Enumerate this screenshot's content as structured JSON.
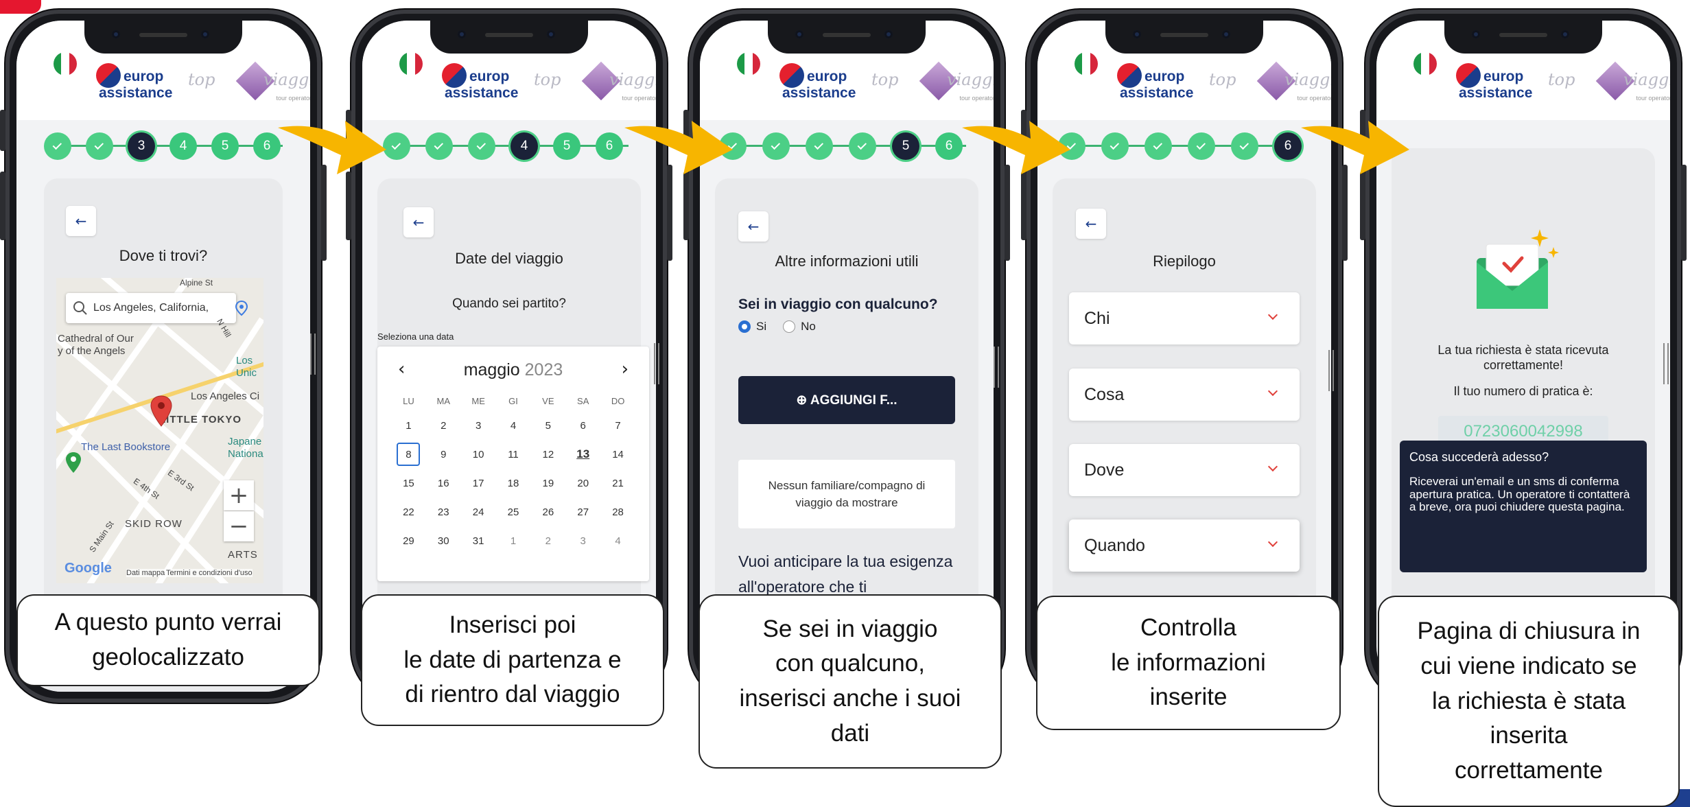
{
  "brand": {
    "logo_left_line1": "europ",
    "logo_left_line2": "assistance",
    "logo_right_left": "top",
    "logo_right_right": "viaggi",
    "logo_right_sub": "tour operator"
  },
  "colors": {
    "accent_green": "#3ac77c",
    "dark_navy": "#1b2238",
    "arrow_yellow": "#f7b500",
    "brand_red": "#e5172f",
    "brand_blue": "#1b3d8c"
  },
  "steps": [
    "1",
    "2",
    "3",
    "4",
    "5",
    "6"
  ],
  "screens": [
    {
      "current_step": 3,
      "title": "Dove ti trovi?",
      "back_label": "←",
      "map": {
        "search_value": "Los Angeles, California,",
        "places": [
          "Cathedral of Our",
          "y of the Angels",
          "Los",
          "Unic",
          "Los Angeles Ci",
          "LITTLE TOKYO",
          "The Last Bookstore",
          "Japane",
          "Nationa",
          "SKID ROW",
          "ARTS",
          "Alpine St",
          "N Hill",
          "E 3rd St",
          "E 4th St",
          "S Main St"
        ],
        "zoom_in": "+",
        "zoom_out": "−",
        "footer_data": "Dati mappa",
        "footer_terms": "Termini e condizioni d'uso",
        "google": "Google"
      },
      "caption": "A questo punto verrai geolocalizzato"
    },
    {
      "current_step": 4,
      "title": "Date del viaggio",
      "subtitle": "Quando sei partito?",
      "back_label": "←",
      "select_label": "Seleziona una data",
      "calendar": {
        "month": "maggio",
        "year": "2023",
        "prev": "‹",
        "next": "›",
        "weekdays": [
          "LU",
          "MA",
          "ME",
          "GI",
          "VE",
          "SA",
          "DO"
        ],
        "days": [
          "1",
          "2",
          "3",
          "4",
          "5",
          "6",
          "7",
          "8",
          "9",
          "10",
          "11",
          "12",
          "13",
          "14",
          "15",
          "16",
          "17",
          "18",
          "19",
          "20",
          "21",
          "22",
          "23",
          "24",
          "25",
          "26",
          "27",
          "28",
          "29",
          "30",
          "31",
          "1",
          "2",
          "3",
          "4"
        ],
        "selected": "8",
        "today": "13"
      },
      "caption_lines": [
        "Inserisci poi",
        "le date di partenza e",
        "di rientro dal viaggio"
      ]
    },
    {
      "current_step": 5,
      "title": "Altre informazioni utili",
      "back_label": "←",
      "question": "Sei in viaggio con qualcuno?",
      "radio_yes": "Si",
      "radio_no": "No",
      "add_button": "⊕ AGGIUNGI F...",
      "empty_text": "Nessun familiare/compagno di viaggio da mostrare",
      "followup": "Vuoi anticipare la tua esigenza all'operatore che ti",
      "caption_lines": [
        "Se sei in viaggio",
        "con qualcuno,",
        "inserisci anche i suoi",
        "dati"
      ]
    },
    {
      "current_step": 6,
      "title": "Riepilogo",
      "back_label": "←",
      "sections": [
        "Chi",
        "Cosa",
        "Dove",
        "Quando"
      ],
      "caption_lines": [
        "Controlla",
        "le informazioni",
        "inserite"
      ]
    },
    {
      "message": "La tua richiesta è stata ricevuta correttamente!",
      "practice_label": "Il tuo numero di pratica è:",
      "practice_number": "0723060042998",
      "info_title": "Cosa succederà adesso?",
      "info_body": "Riceverai un'email e un sms di conferma apertura pratica. Un operatore ti contatterà a breve, ora puoi chiudere questa pagina.",
      "caption_lines": [
        "Pagina di chiusura in",
        "cui viene indicato se",
        "la richiesta è stata",
        "inserita",
        "correttamente"
      ]
    }
  ]
}
